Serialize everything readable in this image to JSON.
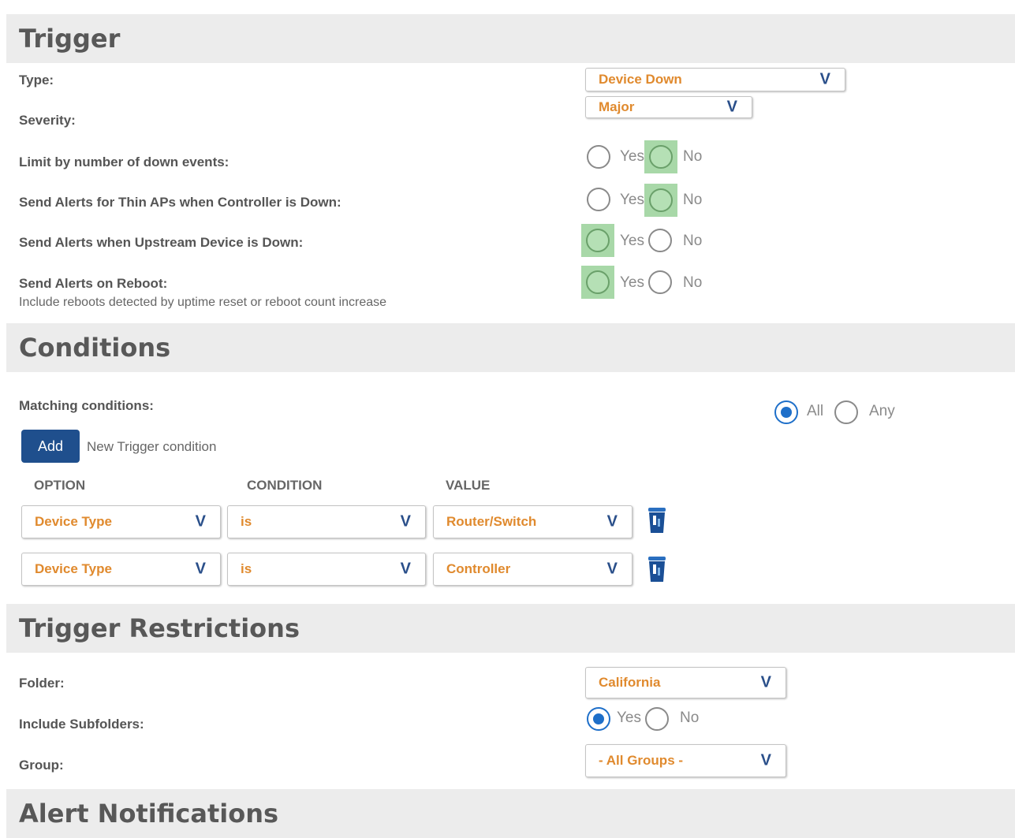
{
  "trigger": {
    "title": "Trigger",
    "type_label": "Type:",
    "type_value": "Device Down",
    "severity_label": "Severity:",
    "severity_value": "Major",
    "limit_label": "Limit by number of down events:",
    "thin_label": "Send Alerts for Thin APs when Controller is Down:",
    "upstream_label": "Send Alerts when Upstream Device is Down:",
    "reboot_label": "Send Alerts on Reboot:",
    "reboot_sub": "Include reboots detected by uptime reset or reboot count increase",
    "yes": "Yes",
    "no": "No",
    "limit_selected": "No",
    "thin_selected": "No",
    "upstream_selected": "Yes",
    "reboot_selected": "Yes"
  },
  "conditions": {
    "title": "Conditions",
    "matching_label": "Matching conditions:",
    "all": "All",
    "any": "Any",
    "matching_selected": "All",
    "add_button": "Add",
    "add_text": "New Trigger condition",
    "col_option": "OPTION",
    "col_condition": "CONDITION",
    "col_value": "VALUE",
    "rows": [
      {
        "option": "Device Type",
        "condition": "is",
        "value": "Router/Switch"
      },
      {
        "option": "Device Type",
        "condition": "is",
        "value": "Controller"
      }
    ]
  },
  "restrictions": {
    "title": "Trigger Restrictions",
    "folder_label": "Folder:",
    "folder_value": "California",
    "subfolders_label": "Include Subfolders:",
    "subfolders_selected": "Yes",
    "group_label": "Group:",
    "group_value": "- All Groups -"
  },
  "notifications": {
    "title": "Alert Notifications"
  },
  "icons": {
    "chevron": "V",
    "trash": "trash-icon"
  },
  "colors": {
    "accent_orange": "#e08a2e",
    "chevron_blue": "#2a4f8a",
    "button_blue": "#1f4f8d",
    "highlight_green": "#a8d8a8",
    "radio_blue": "#1e6fc9"
  }
}
